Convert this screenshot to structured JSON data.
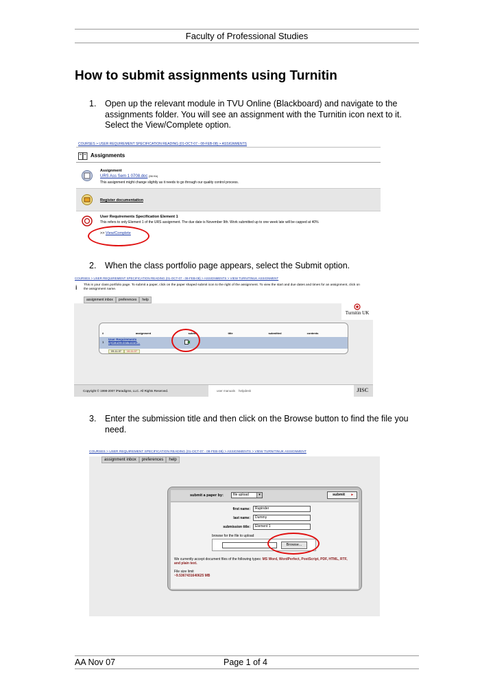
{
  "header": {
    "text": "Faculty of Professional Studies"
  },
  "title": "How to submit assignments using Turnitin",
  "steps": [
    {
      "num": "1.",
      "text": "Open up the relevant module in TVU Online (Blackboard) and navigate to the assignments folder. You will see an assignment with the Turnitin icon next to it.  Select the View/Complete option."
    },
    {
      "num": "2.",
      "text": "When the class portfolio page appears, select the Submit option."
    },
    {
      "num": "3.",
      "text": "Enter the submission title and then click on the Browse button to find the file you need."
    }
  ],
  "shot1": {
    "breadcrumb": "COURSES > USER REQUIREMENT SPECIFICATION READING (01-OCT-07 - 08-FEB-08) > ASSIGNMENTS",
    "section_title": "Assignments",
    "items": [
      {
        "heading": "Assignment",
        "link": "URS Ass Sem 1 0708.doc",
        "size": "(56 Kb)",
        "desc": "This assignment might change slightly as it needs to go through our quality control process.",
        "icon": "document-icon"
      },
      {
        "heading": "",
        "link": "Register documentation",
        "size": "",
        "desc": "",
        "icon": "folder-icon"
      },
      {
        "heading": "User Requirements Specification Element 1",
        "link": "",
        "size": "",
        "desc": "This refers to only Element 1 of the URS assignment. The due date is November 9th. Work submitted up to one week late will be capped at 40%",
        "icon": "turnitin-icon"
      }
    ],
    "view_prefix": ">> ",
    "view_link": "View/Complete"
  },
  "shot2": {
    "breadcrumb": "COURSES > USER REQUIREMENT SPECIFICATION READING (01-OCT-07 - 08-FEB-08) > ASSIGNMENTS > VIEW TURNITINUK ASSIGNMENT",
    "info": "This is your class portfolio page. To submit a paper, click on the paper shaped submit icon to the right of the assignment. To view the start and due dates and times for an assignment, click on the assignment name.",
    "tabs": [
      "assignment inbox",
      "preferences",
      "help"
    ],
    "logo": "Turnitin UK",
    "columns": [
      "#",
      "assignment",
      "submit",
      "title",
      "submitted",
      "contents"
    ],
    "row": {
      "num": "1",
      "name": "User Requirements Specification Eleme...",
      "start": "09-11-07",
      "due": "10-11-07"
    },
    "copyright": "Copyright © 1998-2007 iParadigms, LLC. All Rights Reserved.",
    "footer_links": [
      "user manuals",
      "helpdesk"
    ],
    "jisc": "JISC"
  },
  "shot3": {
    "breadcrumb": "COURSES > USER REQUIREMENT SPECIFICATION READING (01-OCT-07 - 08-FEB-08) > ASSIGNMENTS > VIEW TURNITINUK ASSIGNMENT",
    "tabs": [
      "assignment inbox",
      "preferences",
      "help"
    ],
    "submit_by_label": "submit a paper by:",
    "submit_by_value": "file upload",
    "submit_button": "submit",
    "first_name_label": "first name:",
    "first_name": "Rupinder",
    "last_name_label": "last name:",
    "last_name": "Dummy",
    "title_label": "submission title:",
    "title_value": "Element 1",
    "browse_label": "browse for the file to upload",
    "browse_button": "Browse...",
    "accept_prefix": "We currently accept document files of the following types:",
    "accept_types": "MS Word, WordPerfect, PostScript, PDF, HTML, RTF, and plain text.",
    "limit_label": "File size limit",
    "limit_value": "~9.5367431640625 MB"
  },
  "footer": {
    "left": "AA Nov 07",
    "center": "Page 1 of 4"
  }
}
